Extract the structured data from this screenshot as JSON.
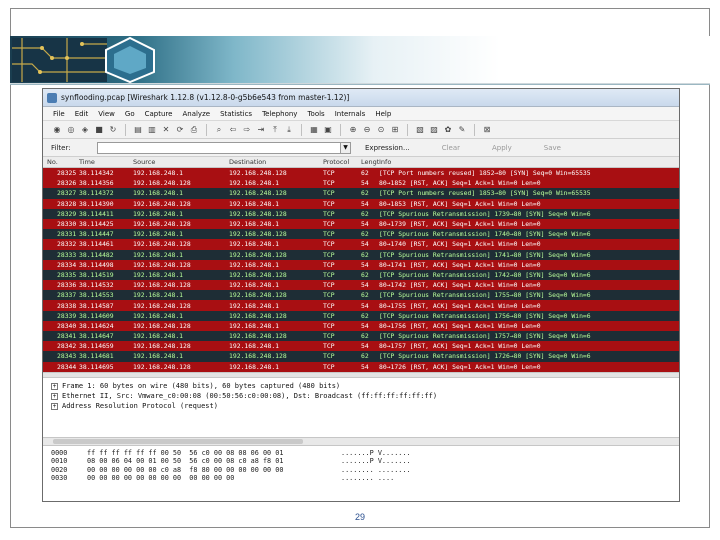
{
  "window": {
    "title": "synflooding.pcap   [Wireshark 1.12.8  (v1.12.8-0-g5b6e543 from master-1.12)]"
  },
  "menu": [
    "File",
    "Edit",
    "View",
    "Go",
    "Capture",
    "Analyze",
    "Statistics",
    "Telephony",
    "Tools",
    "Internals",
    "Help"
  ],
  "filter": {
    "label": "Filter:",
    "value": "",
    "expression": "Expression...",
    "clear": "Clear",
    "apply": "Apply",
    "save": "Save"
  },
  "packet_list": {
    "columns": [
      "No.",
      "Time",
      "Source",
      "Destination",
      "Protocol",
      "Length",
      "Info"
    ],
    "rows": [
      {
        "no": "28325",
        "time": "38.114342",
        "src": "192.168.248.1",
        "dst": "192.168.248.128",
        "proto": "TCP",
        "len": "62",
        "info": "[TCP Port numbers reused] 1852→80 [SYN] Seq=0 Win=65535",
        "style": "red"
      },
      {
        "no": "28326",
        "time": "38.114356",
        "src": "192.168.248.128",
        "dst": "192.168.248.1",
        "proto": "TCP",
        "len": "54",
        "info": "80→1852 [RST, ACK] Seq=1 Ack=1 Win=0 Len=0",
        "style": "red"
      },
      {
        "no": "28327",
        "time": "38.114372",
        "src": "192.168.248.1",
        "dst": "192.168.248.128",
        "proto": "TCP",
        "len": "62",
        "info": "[TCP Port numbers reused] 1853→80 [SYN] Seq=0 Win=65535",
        "style": "dark"
      },
      {
        "no": "28328",
        "time": "38.114390",
        "src": "192.168.248.128",
        "dst": "192.168.248.1",
        "proto": "TCP",
        "len": "54",
        "info": "80→1853 [RST, ACK] Seq=1 Ack=1 Win=0 Len=0",
        "style": "red"
      },
      {
        "no": "28329",
        "time": "38.114411",
        "src": "192.168.248.1",
        "dst": "192.168.248.128",
        "proto": "TCP",
        "len": "62",
        "info": "[TCP Spurious Retransmission] 1739→80 [SYN] Seq=0 Win=6",
        "style": "dark"
      },
      {
        "no": "28330",
        "time": "38.114425",
        "src": "192.168.248.128",
        "dst": "192.168.248.1",
        "proto": "TCP",
        "len": "54",
        "info": "80→1739 [RST, ACK] Seq=1 Ack=1 Win=0 Len=0",
        "style": "red"
      },
      {
        "no": "28331",
        "time": "38.114447",
        "src": "192.168.248.1",
        "dst": "192.168.248.128",
        "proto": "TCP",
        "len": "62",
        "info": "[TCP Spurious Retransmission] 1740→80 [SYN] Seq=0 Win=6",
        "style": "dark"
      },
      {
        "no": "28332",
        "time": "38.114461",
        "src": "192.168.248.128",
        "dst": "192.168.248.1",
        "proto": "TCP",
        "len": "54",
        "info": "80→1740 [RST, ACK] Seq=1 Ack=1 Win=0 Len=0",
        "style": "red"
      },
      {
        "no": "28333",
        "time": "38.114482",
        "src": "192.168.248.1",
        "dst": "192.168.248.128",
        "proto": "TCP",
        "len": "62",
        "info": "[TCP Spurious Retransmission] 1741→80 [SYN] Seq=0 Win=6",
        "style": "dark"
      },
      {
        "no": "28334",
        "time": "38.114498",
        "src": "192.168.248.128",
        "dst": "192.168.248.1",
        "proto": "TCP",
        "len": "54",
        "info": "80→1741 [RST, ACK] Seq=1 Ack=1 Win=0 Len=0",
        "style": "red"
      },
      {
        "no": "28335",
        "time": "38.114519",
        "src": "192.168.248.1",
        "dst": "192.168.248.128",
        "proto": "TCP",
        "len": "62",
        "info": "[TCP Spurious Retransmission] 1742→80 [SYN] Seq=0 Win=6",
        "style": "dark"
      },
      {
        "no": "28336",
        "time": "38.114532",
        "src": "192.168.248.128",
        "dst": "192.168.248.1",
        "proto": "TCP",
        "len": "54",
        "info": "80→1742 [RST, ACK] Seq=1 Ack=1 Win=0 Len=0",
        "style": "red"
      },
      {
        "no": "28337",
        "time": "38.114553",
        "src": "192.168.248.1",
        "dst": "192.168.248.128",
        "proto": "TCP",
        "len": "62",
        "info": "[TCP Spurious Retransmission] 1755→80 [SYN] Seq=0 Win=6",
        "style": "dark"
      },
      {
        "no": "28338",
        "time": "38.114587",
        "src": "192.168.248.128",
        "dst": "192.168.248.1",
        "proto": "TCP",
        "len": "54",
        "info": "80→1755 [RST, ACK] Seq=1 Ack=1 Win=0 Len=0",
        "style": "red"
      },
      {
        "no": "28339",
        "time": "38.114609",
        "src": "192.168.248.1",
        "dst": "192.168.248.128",
        "proto": "TCP",
        "len": "62",
        "info": "[TCP Spurious Retransmission] 1756→80 [SYN] Seq=0 Win=6",
        "style": "dark"
      },
      {
        "no": "28340",
        "time": "38.114624",
        "src": "192.168.248.128",
        "dst": "192.168.248.1",
        "proto": "TCP",
        "len": "54",
        "info": "80→1756 [RST, ACK] Seq=1 Ack=1 Win=0 Len=0",
        "style": "red"
      },
      {
        "no": "28341",
        "time": "38.114647",
        "src": "192.168.248.1",
        "dst": "192.168.248.128",
        "proto": "TCP",
        "len": "62",
        "info": "[TCP Spurious Retransmission] 1757→80 [SYN] Seq=0 Win=6",
        "style": "dark"
      },
      {
        "no": "28342",
        "time": "38.114659",
        "src": "192.168.248.128",
        "dst": "192.168.248.1",
        "proto": "TCP",
        "len": "54",
        "info": "80→1757 [RST, ACK] Seq=1 Ack=1 Win=0 Len=0",
        "style": "red"
      },
      {
        "no": "28343",
        "time": "38.114681",
        "src": "192.168.248.1",
        "dst": "192.168.248.128",
        "proto": "TCP",
        "len": "62",
        "info": "[TCP Spurious Retransmission] 1726→80 [SYN] Seq=0 Win=6",
        "style": "dark"
      },
      {
        "no": "28344",
        "time": "38.114695",
        "src": "192.168.248.128",
        "dst": "192.168.248.1",
        "proto": "TCP",
        "len": "54",
        "info": "80→1726 [RST, ACK] Seq=1 Ack=1 Win=0 Len=0",
        "style": "red"
      }
    ]
  },
  "details": [
    "Frame 1: 60 bytes on wire (480 bits), 60 bytes captured (480 bits)",
    "Ethernet II, Src: Vmware_c0:00:08 (00:50:56:c0:00:08), Dst: Broadcast (ff:ff:ff:ff:ff:ff)",
    "Address Resolution Protocol (request)"
  ],
  "bytes": [
    {
      "offset": "0000",
      "hex": "ff ff ff ff ff ff 00 50  56 c0 00 08 08 06 00 01",
      "ascii": ".......P V......."
    },
    {
      "offset": "0010",
      "hex": "08 00 06 04 00 01 00 50  56 c0 00 08 c0 a8 f8 01",
      "ascii": ".......P V......."
    },
    {
      "offset": "0020",
      "hex": "00 00 00 00 00 00 c0 a8  f8 80 00 00 00 00 00 00",
      "ascii": "........ ........"
    },
    {
      "offset": "0030",
      "hex": "00 00 00 00 00 00 00 00  00 00 00 00",
      "ascii": "........ ...."
    }
  ],
  "slide": {
    "page_number": "29"
  }
}
